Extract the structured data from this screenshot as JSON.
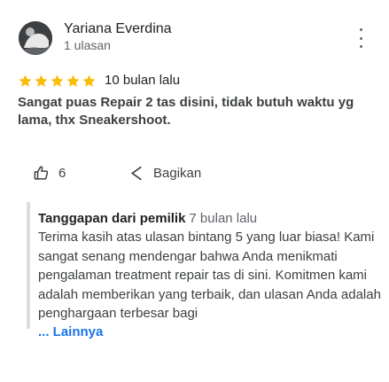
{
  "review": {
    "reviewer_name": "Yariana Everdina",
    "reviewer_meta": "1 ulasan",
    "rating": 5,
    "rating_max": 5,
    "time_ago": "10 bulan lalu",
    "text": "Sangat puas Repair 2 tas disini, tidak butuh waktu yg lama, thx Sneakershoot.",
    "like_count": "6",
    "share_label": "Bagikan"
  },
  "owner_response": {
    "title": "Tanggapan dari pemilik",
    "time_ago": "7 bulan lalu",
    "text": "Terima kasih atas ulasan bintang 5 yang luar biasa! Kami sangat senang mendengar bahwa Anda menikmati pengalaman treatment repair tas di sini. Komitmen kami adalah memberikan yang terbaik, dan ulasan Anda adalah penghargaan terbesar bagi",
    "more_label": "... Lainnya"
  },
  "colors": {
    "star": "#fbbc04",
    "link": "#1a73e8",
    "text_primary": "#202124",
    "text_secondary": "#5f6368",
    "owner_border": "#dadce0"
  },
  "icons": {
    "avatar": "profile-photo-avatar",
    "more": "more-vertical-icon",
    "star": "star-icon",
    "like": "thumb-up-icon",
    "share": "share-icon"
  }
}
